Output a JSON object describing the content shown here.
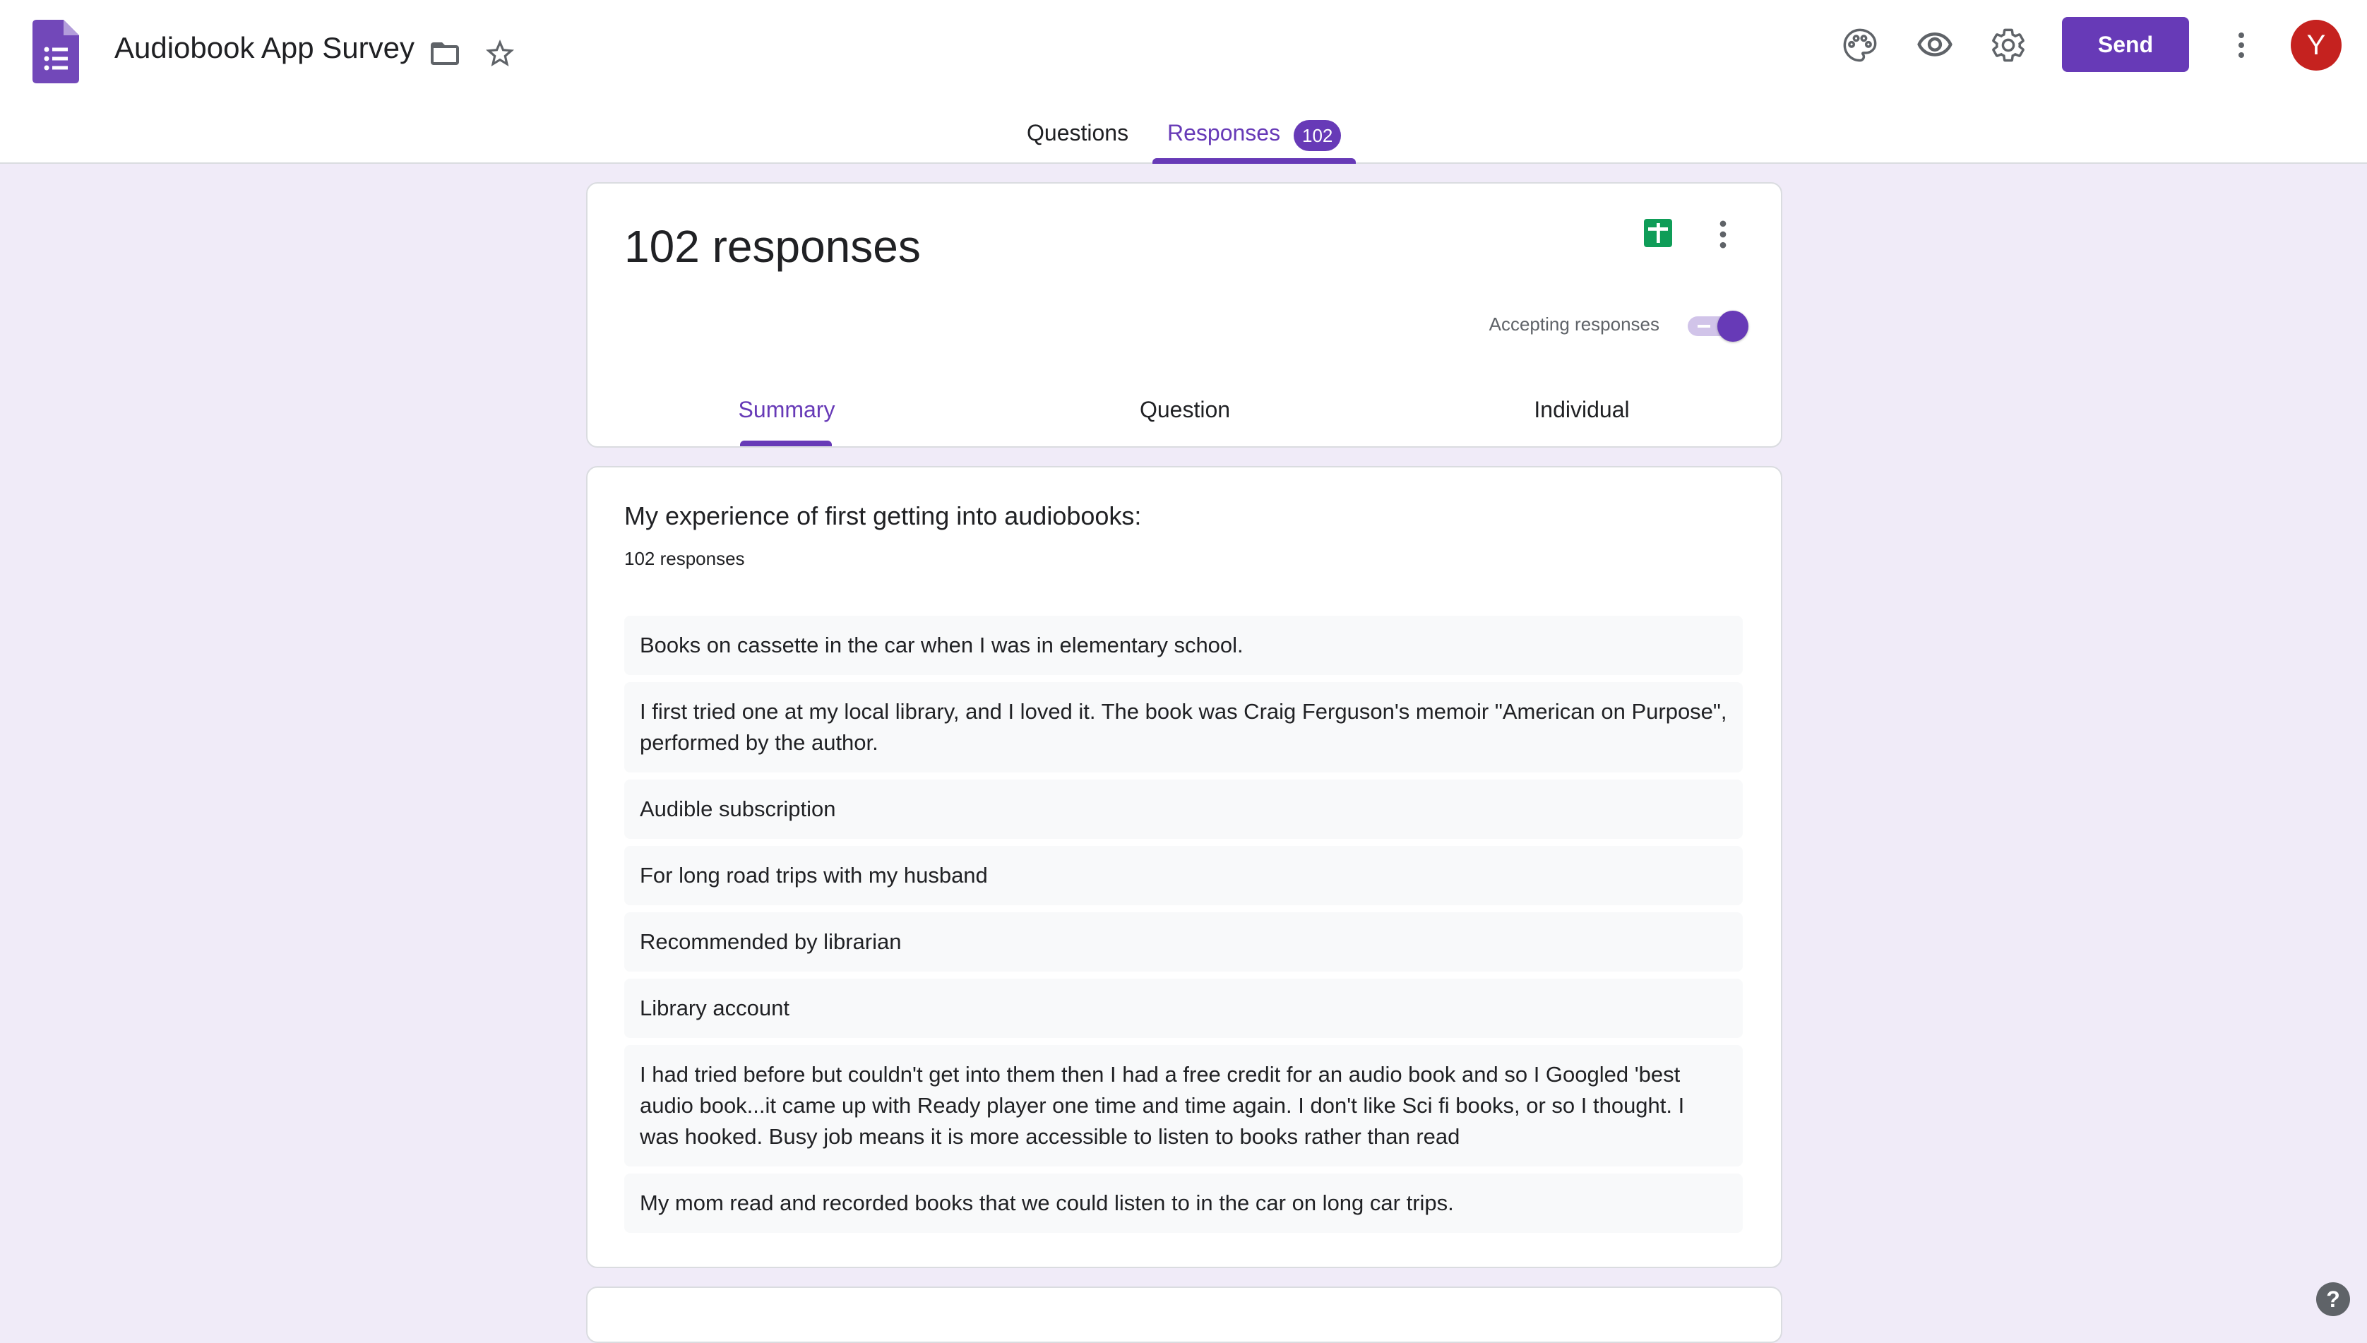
{
  "app": {
    "title": "Audiobook App Survey",
    "icons": [
      "forms-logo-icon",
      "folder-icon",
      "star-icon",
      "palette-icon",
      "eye-icon",
      "gear-icon",
      "more-vert-icon"
    ],
    "send_label": "Send",
    "avatar_letter": "Y",
    "brand_color": "#673ab7"
  },
  "top_tabs": {
    "questions": "Questions",
    "responses": "Responses",
    "responses_badge": "102"
  },
  "summary_card": {
    "title": "102 responses",
    "accepting_label": "Accepting responses",
    "accepting": true,
    "tabs": {
      "summary": "Summary",
      "question": "Question",
      "individual": "Individual"
    }
  },
  "question": {
    "title": "My experience of first getting into audiobooks:",
    "count": "102 responses",
    "answers": [
      "Books on cassette in the car when I was in elementary school.",
      "I first tried one at my local library, and I loved it. The book was Craig Ferguson's memoir \"American on Purpose\", performed by the author.",
      "Audible subscription",
      "For long road trips with my husband",
      "Recommended by librarian",
      "Library account",
      "I had tried before but couldn't get into them then I had a free credit for an audio book and so I Googled 'best audio book...it came up with Ready player one time and time again. I don't like Sci fi books, or so I thought. I was hooked. Busy job means it is more accessible to listen to books rather than read",
      "My mom read and recorded books that we could listen to in the car on long car trips."
    ]
  },
  "help_label": "?"
}
